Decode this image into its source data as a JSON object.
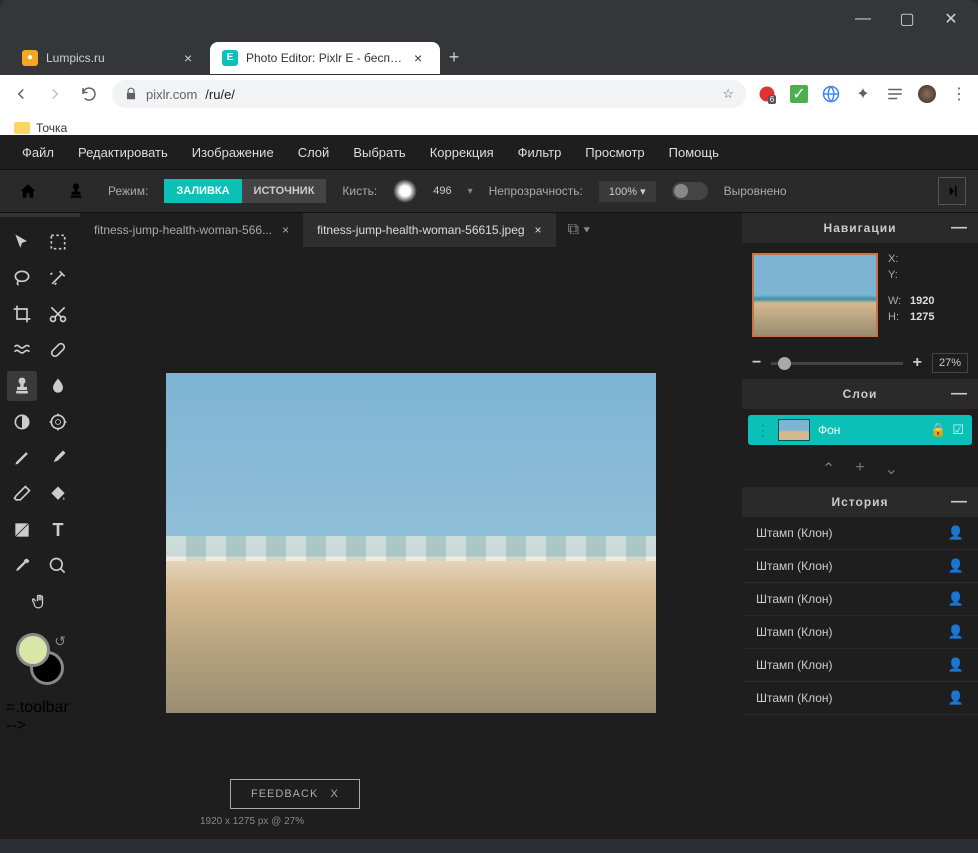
{
  "browser": {
    "tabs": [
      {
        "title": "Lumpics.ru",
        "active": false
      },
      {
        "title": "Photo Editor: Pixlr E - бесплатн",
        "active": true
      }
    ],
    "url_host": "pixlr.com",
    "url_path": "/ru/e/",
    "bookmark": "Точка"
  },
  "menu": [
    "Файл",
    "Редактировать",
    "Изображение",
    "Слой",
    "Выбрать",
    "Коррекция",
    "Фильтр",
    "Просмотр",
    "Помощь"
  ],
  "options": {
    "mode_label": "Режим:",
    "mode_fill": "ЗАЛИВКА",
    "mode_source": "ИСТОЧНИК",
    "brush_label": "Кисть:",
    "brush_size": "496",
    "opacity_label": "Непрозрачность:",
    "opacity_value": "100%  ▾",
    "aligned": "Выровнено"
  },
  "docs": [
    {
      "name": "fitness-jump-health-woman-566...",
      "active": false
    },
    {
      "name": "fitness-jump-health-woman-56615.jpeg",
      "active": true
    }
  ],
  "feedback": "FEEDBACK",
  "status": "1920 x 1275 px @ 27%",
  "panels": {
    "nav_title": "Навигации",
    "coords": {
      "x": "X:",
      "y": "Y:",
      "w": "W:",
      "h": "H:",
      "w_val": "1920",
      "h_val": "1275"
    },
    "zoom": "27%",
    "layers_title": "Слои",
    "layer_name": "Фон",
    "history_title": "История",
    "history_items": [
      "Штамп (Клон)",
      "Штамп (Клон)",
      "Штамп (Клон)",
      "Штамп (Клон)",
      "Штамп (Клон)",
      "Штамп (Клон)"
    ]
  }
}
